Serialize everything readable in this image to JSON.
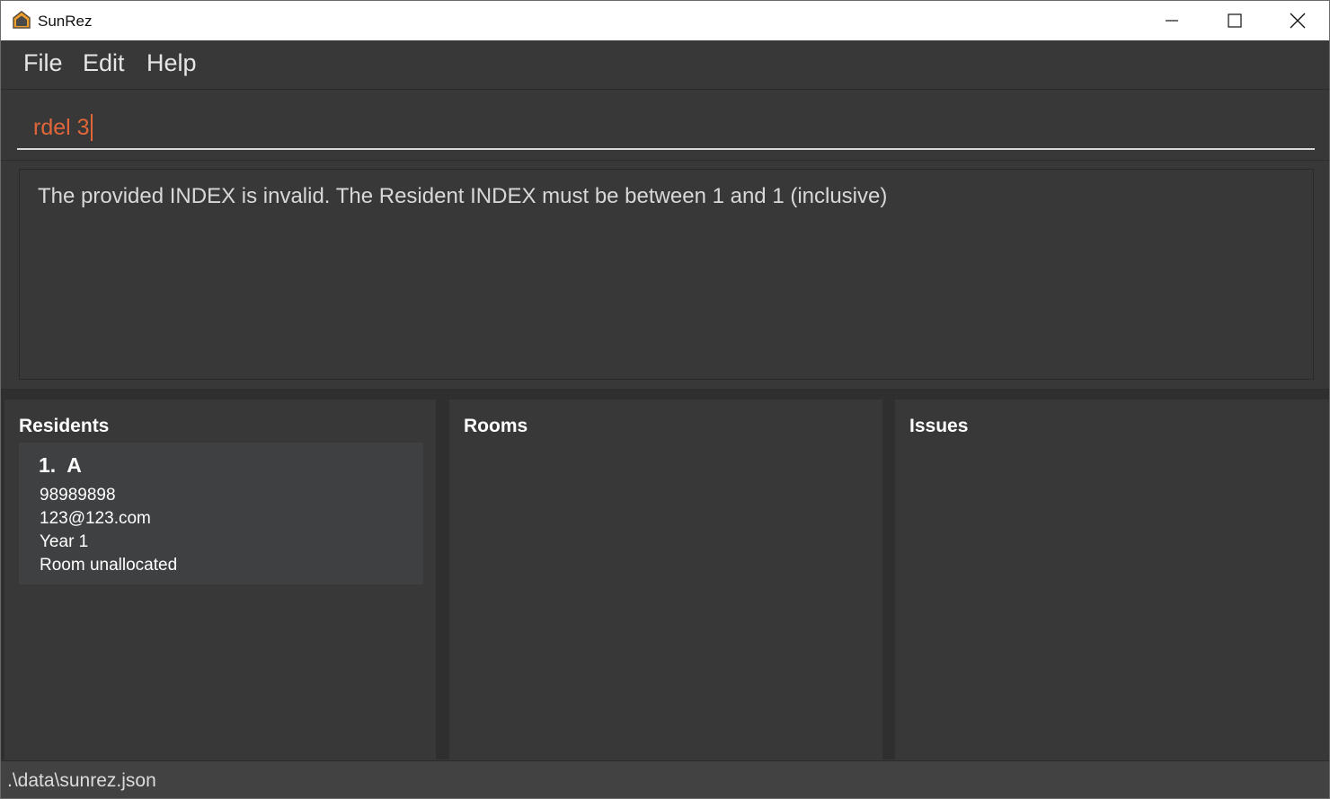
{
  "window": {
    "title": "SunRez"
  },
  "menu": {
    "file": "File",
    "edit": "Edit",
    "help": "Help"
  },
  "command": {
    "value": "rdel 3"
  },
  "result": {
    "message": "The provided INDEX is invalid. The Resident INDEX must be between 1 and 1 (inclusive)"
  },
  "panels": {
    "residents": {
      "title": "Residents",
      "items": [
        {
          "index": "1.",
          "name": "A",
          "phone": "98989898",
          "email": "123@123.com",
          "year": "Year 1",
          "room": "Room unallocated"
        }
      ]
    },
    "rooms": {
      "title": "Rooms"
    },
    "issues": {
      "title": "Issues"
    }
  },
  "status": {
    "path": ".\\data\\sunrez.json"
  },
  "colors": {
    "background": "#383838",
    "command_text": "#e0663a",
    "card": "#3f4042"
  }
}
